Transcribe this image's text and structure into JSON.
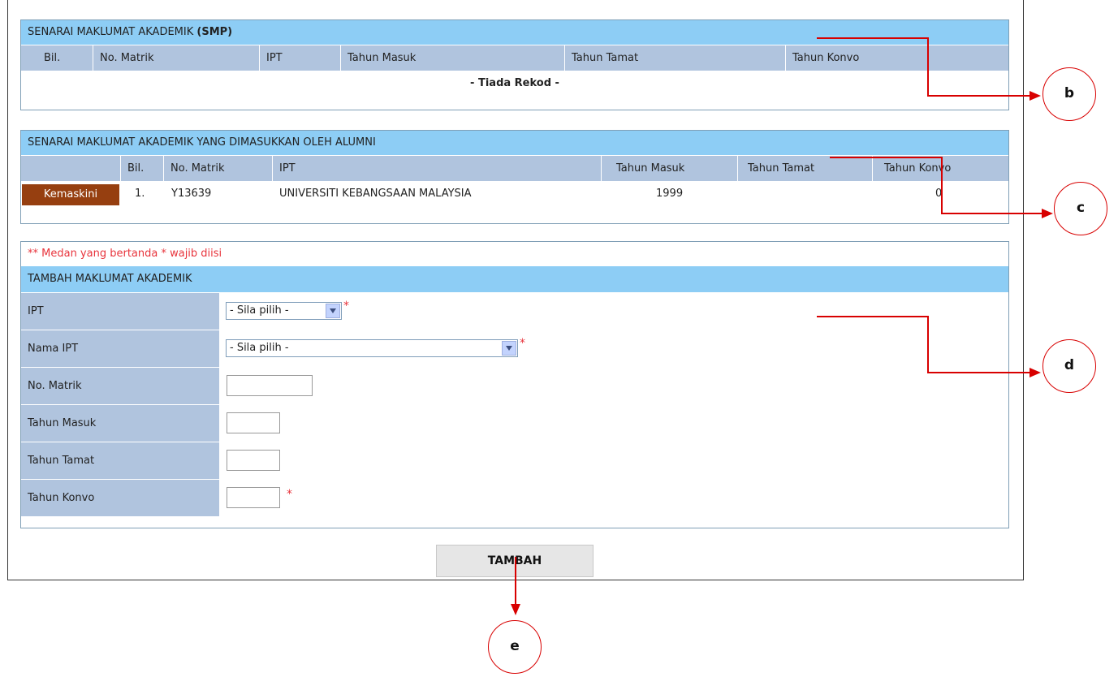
{
  "smp_panel": {
    "title_prefix": "SENARAI MAKLUMAT AKADEMIK ",
    "title_bold": "(SMP)",
    "headers": [
      "Bil.",
      "No. Matrik",
      "IPT",
      "Tahun Masuk",
      "Tahun Tamat",
      "Tahun Konvo"
    ],
    "no_record": "- Tiada Rekod -"
  },
  "alumni_panel": {
    "title": "SENARAI MAKLUMAT AKADEMIK YANG DIMASUKKAN OLEH ALUMNI",
    "headers": [
      "Bil.",
      "No. Matrik",
      "IPT",
      "Tahun Masuk",
      "Tahun Tamat",
      "Tahun Konvo"
    ],
    "rows": [
      {
        "action": "Kemaskini",
        "bil": "1.",
        "no_matrik": "Y13639",
        "ipt": "UNIVERSITI KEBANGSAAN MALAYSIA",
        "tahun_masuk": "1999",
        "tahun_tamat": "",
        "tahun_konvo": "0"
      }
    ]
  },
  "form_panel": {
    "note": "** Medan yang bertanda * wajib diisi",
    "title": "TAMBAH MAKLUMAT AKADEMIK",
    "required_mark": "*",
    "fields": {
      "ipt": {
        "label": "IPT",
        "value": "- Sila pilih -"
      },
      "nama_ipt": {
        "label": "Nama IPT",
        "value": "- Sila pilih -"
      },
      "no_matrik": {
        "label": "No. Matrik",
        "value": ""
      },
      "tahun_masuk": {
        "label": "Tahun Masuk",
        "value": ""
      },
      "tahun_tamat": {
        "label": "Tahun Tamat",
        "value": ""
      },
      "tahun_konvo": {
        "label": "Tahun Konvo",
        "value": ""
      }
    },
    "submit_label": "TAMBAH"
  },
  "callouts": {
    "b": "b",
    "c": "c",
    "d": "d",
    "e": "e"
  },
  "colors": {
    "title_bar": "#8dcdf5",
    "header_row": "#b0c4de",
    "panel_border": "#7f9fb6",
    "edit_button": "#963f10",
    "required": "#e8343c",
    "callout_red": "#d80000"
  }
}
